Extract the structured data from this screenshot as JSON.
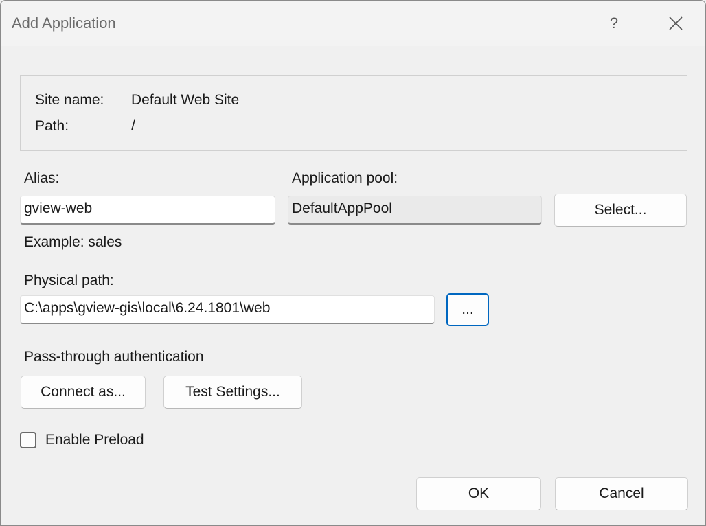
{
  "window": {
    "title": "Add Application",
    "help_icon": "?",
    "close_icon": "✕"
  },
  "site_info": {
    "site_name_label": "Site name:",
    "site_name_value": "Default Web Site",
    "path_label": "Path:",
    "path_value": "/"
  },
  "alias": {
    "label": "Alias:",
    "value": "gview-web",
    "example": "Example: sales"
  },
  "app_pool": {
    "label": "Application pool:",
    "value": "DefaultAppPool",
    "select_button": "Select..."
  },
  "physical_path": {
    "label": "Physical path:",
    "value": "C:\\apps\\gview-gis\\local\\6.24.1801\\web",
    "browse_button": "..."
  },
  "auth": {
    "label": "Pass-through authentication",
    "connect_as_button": "Connect as...",
    "test_settings_button": "Test Settings..."
  },
  "preload": {
    "label": "Enable Preload",
    "checked": false
  },
  "footer": {
    "ok_button": "OK",
    "cancel_button": "Cancel"
  },
  "colors": {
    "focus_accent": "#0067c0",
    "dialog_background": "#f0f0f0"
  }
}
